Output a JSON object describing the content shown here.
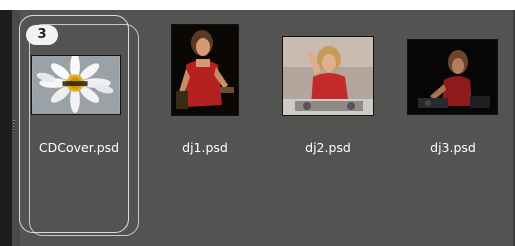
{
  "browser": {
    "items": [
      {
        "filename": "CDCover.psd",
        "stack_count": "3"
      },
      {
        "filename": "dj1.psd"
      },
      {
        "filename": "dj2.psd"
      },
      {
        "filename": "dj3.psd"
      }
    ]
  },
  "colors": {
    "panel_background": "#535351",
    "label_text": "#ffffff",
    "stack_outline": "#dcdcda"
  }
}
